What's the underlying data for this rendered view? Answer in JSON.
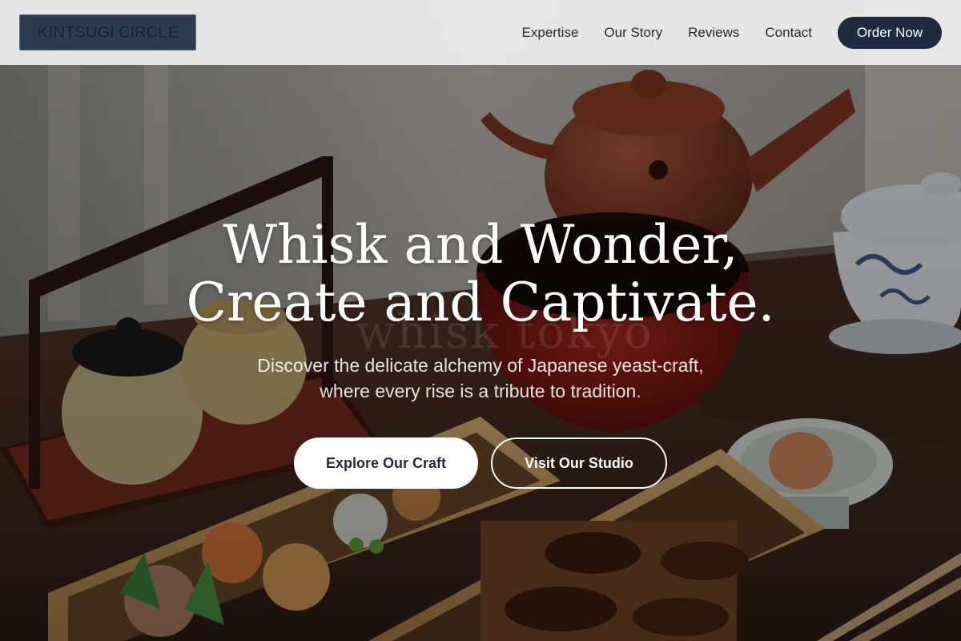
{
  "brand": {
    "logo_text": "KINTSUGI CIRCLE"
  },
  "nav": {
    "links": [
      {
        "label": "Expertise"
      },
      {
        "label": "Our Story"
      },
      {
        "label": "Reviews"
      },
      {
        "label": "Contact"
      }
    ],
    "cta_label": "Order Now"
  },
  "hero": {
    "title_line1": "Whisk and Wonder,",
    "title_line2": "Create and Captivate.",
    "subtitle_line1": "Discover the delicate alchemy of Japanese yeast-craft,",
    "subtitle_line2": "where every rise is a tribute to tradition.",
    "primary_button": "Explore Our Craft",
    "secondary_button": "Visit Our Studio",
    "image_watermark": "whisk tokyo"
  },
  "colors": {
    "header_bg": "#f0f0f0",
    "nav_text": "#1f2937",
    "cta_bg": "#1e2a40",
    "logo_bg": "#2c3a4f",
    "hero_text": "#ffffff"
  }
}
